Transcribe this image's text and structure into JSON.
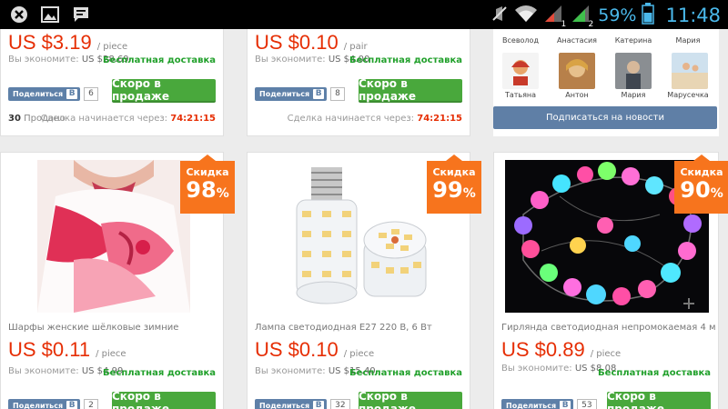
{
  "status_bar": {
    "battery_percent": "59%",
    "time": "11:48",
    "signal_sim1": "1",
    "signal_sim2": "2"
  },
  "top_cards": [
    {
      "price": "US $3.19",
      "unit": "/ piece",
      "save_label": "Вы экономите:",
      "save_amount": "US $28.69",
      "shipping": "Бесплатная доставка",
      "share_label": "Поделиться",
      "vk_label": "В",
      "share_count": "6",
      "button": "Скоро в продаже",
      "sold_count": "30",
      "sold_label": "Продано",
      "deal_label": "Сделка начинается через:",
      "timer": "74:21:15"
    },
    {
      "price": "US $0.10",
      "unit": "/ pair",
      "save_label": "Вы экономите:",
      "save_amount": "US $4.00",
      "shipping": "Бесплатная доставка",
      "share_label": "Поделиться",
      "vk_label": "В",
      "share_count": "8",
      "button": "Скоро в продаже",
      "deal_label": "Сделка начинается через:",
      "timer": "74:21:15"
    }
  ],
  "products": [
    {
      "name": "Шарфы женские шёлковые зимние",
      "discount_label": "Скидка",
      "discount": "98",
      "percent": "%",
      "price": "US $0.11",
      "unit": "/ piece",
      "save_label": "Вы экономите:",
      "save_amount": "US $4.99",
      "shipping": "Бесплатная доставка",
      "share_label": "Поделиться",
      "vk_label": "В",
      "share_count": "2",
      "button": "Скоро в продаже"
    },
    {
      "name": "Лампа светодиодная E27 220 В, 6 Вт",
      "discount_label": "Скидка",
      "discount": "99",
      "percent": "%",
      "price": "US $0.10",
      "unit": "/ piece",
      "save_label": "Вы экономите:",
      "save_amount": "US $15.40",
      "shipping": "Бесплатная доставка",
      "share_label": "Поделиться",
      "vk_label": "В",
      "share_count": "32",
      "button": "Скоро в продаже"
    },
    {
      "name": "Гирлянда светодиодная непромокаемая 4 м",
      "discount_label": "Скидка",
      "discount": "90",
      "percent": "%",
      "price": "US $0.89",
      "unit": "/ piece",
      "save_label": "Вы экономите:",
      "save_amount": "US $8.08",
      "shipping": "Бесплатная доставка",
      "share_label": "Поделиться",
      "vk_label": "В",
      "share_count": "53",
      "button": "Скоро в продаже"
    }
  ],
  "subscribers": {
    "row1": [
      "Всеволод",
      "Анастасия",
      "Катерина",
      "Мария"
    ],
    "row2": [
      "Татьяна",
      "Антон",
      "Мария",
      "Марусечка"
    ],
    "subscribe_button": "Подписаться на новости"
  },
  "colors": {
    "price": "#e62e04",
    "button": "#49a83c",
    "badge": "#f7741d",
    "vk": "#5e80a8",
    "shipping": "#21a02b"
  }
}
